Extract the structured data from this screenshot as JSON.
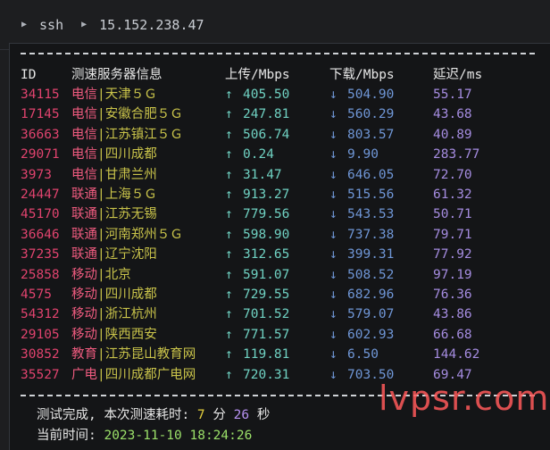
{
  "titlebar": {
    "command": "ssh",
    "host": "15.152.238.47"
  },
  "table": {
    "headers": {
      "id": "ID",
      "name": "测速服务器信息",
      "up": "上传/Mbps",
      "down": "下载/Mbps",
      "latency": "延迟/ms"
    },
    "up_arrow": "↑",
    "down_arrow": "↓",
    "rows": [
      {
        "id": "34115",
        "isp": "电信",
        "loc": "|天津５Ｇ",
        "up": "405.50",
        "down": "504.90",
        "lat": "55.17"
      },
      {
        "id": "17145",
        "isp": "电信",
        "loc": "|安徽合肥５Ｇ",
        "up": "247.81",
        "down": "560.29",
        "lat": "43.68"
      },
      {
        "id": "36663",
        "isp": "电信",
        "loc": "|江苏镇江５Ｇ",
        "up": "506.74",
        "down": "803.57",
        "lat": "40.89"
      },
      {
        "id": "29071",
        "isp": "电信",
        "loc": "|四川成都",
        "up": "0.24",
        "down": "9.90",
        "lat": "283.77"
      },
      {
        "id": "3973",
        "isp": "电信",
        "loc": "|甘肃兰州",
        "up": "31.47",
        "down": "646.05",
        "lat": "72.70"
      },
      {
        "id": "24447",
        "isp": "联通",
        "loc": "|上海５Ｇ",
        "up": "913.27",
        "down": "515.56",
        "lat": "61.32"
      },
      {
        "id": "45170",
        "isp": "联通",
        "loc": "|江苏无锡",
        "up": "779.56",
        "down": "543.53",
        "lat": "50.71"
      },
      {
        "id": "36646",
        "isp": "联通",
        "loc": "|河南郑州５Ｇ",
        "up": "598.90",
        "down": "737.38",
        "lat": "79.71"
      },
      {
        "id": "37235",
        "isp": "联通",
        "loc": "|辽宁沈阳",
        "up": "312.65",
        "down": "399.31",
        "lat": "77.92"
      },
      {
        "id": "25858",
        "isp": "移动",
        "loc": "|北京",
        "up": "591.07",
        "down": "508.52",
        "lat": "97.19"
      },
      {
        "id": "4575",
        "isp": "移动",
        "loc": "|四川成都",
        "up": "729.55",
        "down": "682.96",
        "lat": "76.36"
      },
      {
        "id": "54312",
        "isp": "移动",
        "loc": "|浙江杭州",
        "up": "701.52",
        "down": "579.07",
        "lat": "43.86"
      },
      {
        "id": "29105",
        "isp": "移动",
        "loc": "|陕西西安",
        "up": "771.57",
        "down": "602.93",
        "lat": "66.68"
      },
      {
        "id": "30852",
        "isp": "教育",
        "loc": "|江苏昆山教育网",
        "up": "119.81",
        "down": "6.50",
        "lat": "144.62"
      },
      {
        "id": "35527",
        "isp": "广电",
        "loc": "|四川成都广电网",
        "up": "720.31",
        "down": "703.50",
        "lat": "69.47"
      }
    ]
  },
  "footer": {
    "done_prefix": "测试完成, 本次测速耗时: ",
    "minutes": "7",
    "min_unit": " 分 ",
    "seconds": "26",
    "sec_unit": " 秒",
    "time_label": "当前时间: ",
    "time_value": "2023-11-10 18:24:26"
  },
  "watermark": "lvpsr.com",
  "icons": {
    "prompt_chevron": "chevron-right-icon"
  },
  "colors": {
    "id": "#e0436e",
    "isp": "#ef5b7f",
    "location": "#c9c34a",
    "upload": "#6fd1c2",
    "download": "#6f96d6",
    "latency": "#a58ce0",
    "watermark": "#ff5a5a"
  }
}
